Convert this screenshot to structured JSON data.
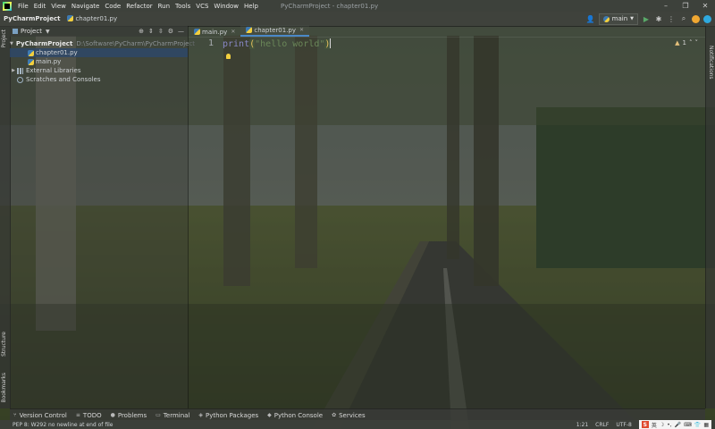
{
  "menubar": {
    "items": [
      "File",
      "Edit",
      "View",
      "Navigate",
      "Code",
      "Refactor",
      "Run",
      "Tools",
      "VCS",
      "Window",
      "Help"
    ],
    "window_title": "PyCharmProject - chapter01.py"
  },
  "navbar": {
    "project": "PyCharmProject",
    "file": "chapter01.py",
    "run_config": "main"
  },
  "project_panel": {
    "title": "Project",
    "tree": [
      {
        "label": "PyCharmProject",
        "path": "D:\\Software\\PyCharm\\PyCharmProject"
      },
      {
        "label": "chapter01.py"
      },
      {
        "label": "main.py"
      },
      {
        "label": "External Libraries"
      },
      {
        "label": "Scratches and Consoles"
      }
    ]
  },
  "left_stripe": {
    "project_tab": "Project",
    "structure_tab": "Structure",
    "bookmarks_tab": "Bookmarks"
  },
  "right_stripe": {
    "notifications_tab": "Notifications"
  },
  "editor": {
    "tabs": [
      {
        "label": "main.py"
      },
      {
        "label": "chapter01.py",
        "active": true
      }
    ],
    "line_number": "1",
    "code": {
      "fn": "print",
      "open_paren": "(",
      "string": "\"hello world\"",
      "close_paren": ")"
    },
    "inspection": {
      "warnings": "1"
    }
  },
  "tool_windows": [
    "Version Control",
    "TODO",
    "Problems",
    "Terminal",
    "Python Packages",
    "Python Console",
    "Services"
  ],
  "status": {
    "message": "PEP 8: W292 no newline at end of file",
    "position": "1:21",
    "line_endings": "CRLF",
    "encoding": "UTF-8",
    "ime_lang": "英"
  },
  "colors": {
    "accent": "#4a88c7",
    "selected_row": "#2e4868",
    "string": "#6a8759",
    "function": "#8888c6",
    "paren": "#e8c15e"
  }
}
